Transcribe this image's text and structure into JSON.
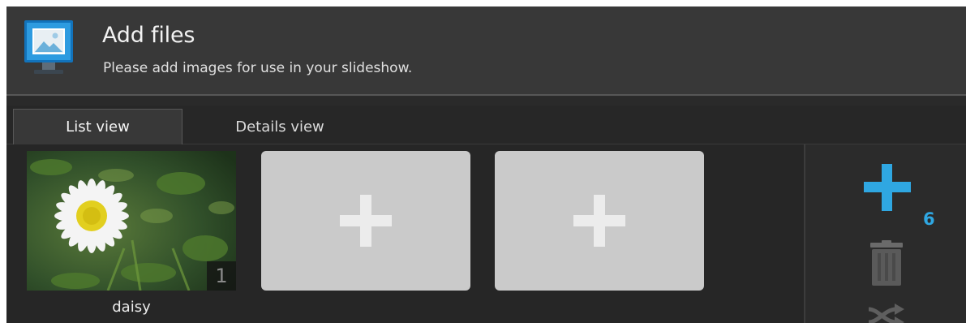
{
  "header": {
    "title": "Add files",
    "subtitle": "Please add images for use in your slideshow.",
    "icon": "monitor-picture-icon"
  },
  "tabs": [
    {
      "label": "List view",
      "active": true
    },
    {
      "label": "Details view",
      "active": false
    }
  ],
  "items": [
    {
      "type": "photo",
      "label": "daisy",
      "index": "1"
    },
    {
      "type": "add-placeholder"
    },
    {
      "type": "add-placeholder"
    }
  ],
  "sidebar": {
    "add_icon": "plus-icon",
    "add_count": "6",
    "delete_icon": "trash-icon",
    "shuffle_icon": "shuffle-icon"
  },
  "colors": {
    "accent": "#2fa7e2",
    "header_bg": "#383838",
    "panel_bg": "#262626",
    "placeholder_bg": "#cacaca"
  }
}
